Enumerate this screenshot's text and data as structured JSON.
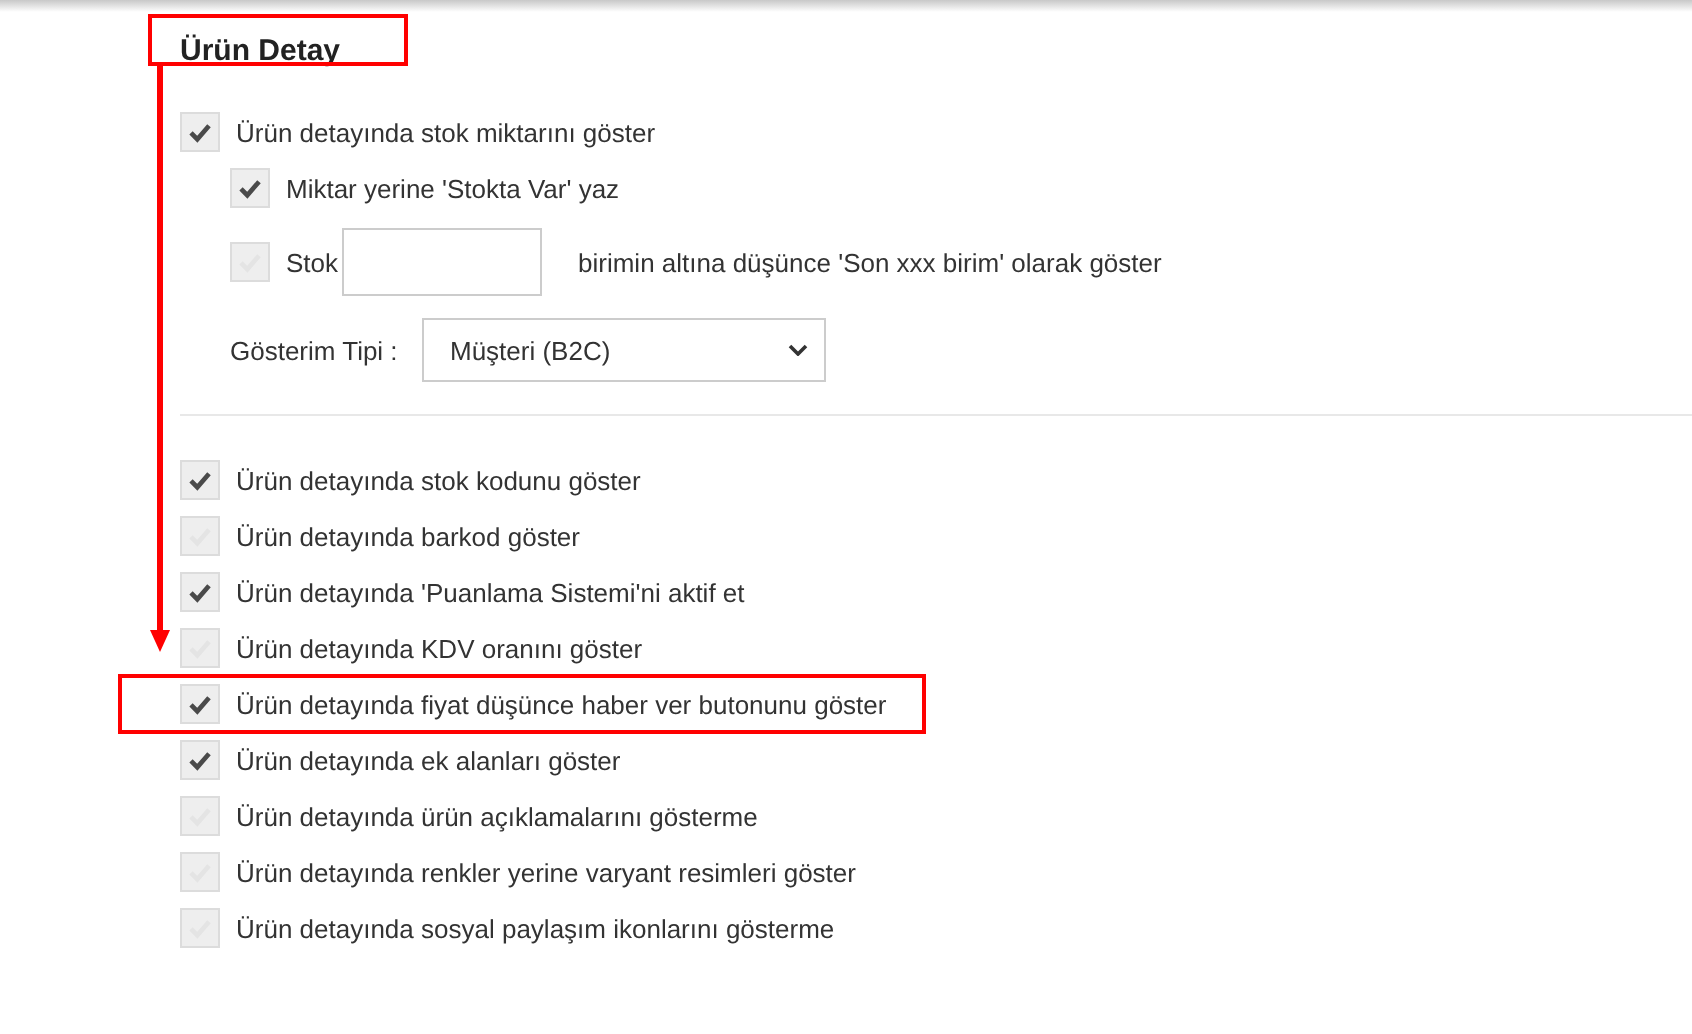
{
  "section_title": {
    "text": "Ürün Detay",
    "highlighted": true
  },
  "stock_option": {
    "label": "Ürün detayında stok miktarını göster",
    "checked": true
  },
  "sub_options": [
    {
      "kind": "checkbox",
      "label": "Miktar yerine 'Stokta Var' yaz",
      "checked": true
    },
    {
      "kind": "threshold",
      "label": "Stok",
      "after": "birimin altına düşünce 'Son xxx birim' olarak göster",
      "checked": false
    }
  ],
  "display_type": {
    "label": "Gösterim Tipi :",
    "value": "Müşteri (B2C)"
  },
  "options": [
    {
      "label": "Ürün detayında stok kodunu göster",
      "checked": true,
      "highlighted": false
    },
    {
      "label": "Ürün detayında barkod göster",
      "checked": false,
      "highlighted": false
    },
    {
      "label": "Ürün detayında 'Puanlama Sistemi'ni aktif et",
      "checked": true,
      "highlighted": false
    },
    {
      "label": "Ürün detayında KDV oranını göster",
      "checked": false,
      "highlighted": false
    },
    {
      "label": "Ürün detayında fiyat düşünce haber ver butonunu göster",
      "checked": true,
      "highlighted": true
    },
    {
      "label": "Ürün detayında ek alanları göster",
      "checked": true,
      "highlighted": false
    },
    {
      "label": "Ürün detayında ürün açıklamalarını gösterme",
      "checked": false,
      "highlighted": false
    },
    {
      "label": "Ürün detayında renkler yerine varyant resimleri göster",
      "checked": false,
      "highlighted": false
    },
    {
      "label": "Ürün detayında sosyal paylaşım ikonlarını gösterme",
      "checked": false,
      "highlighted": false
    }
  ]
}
